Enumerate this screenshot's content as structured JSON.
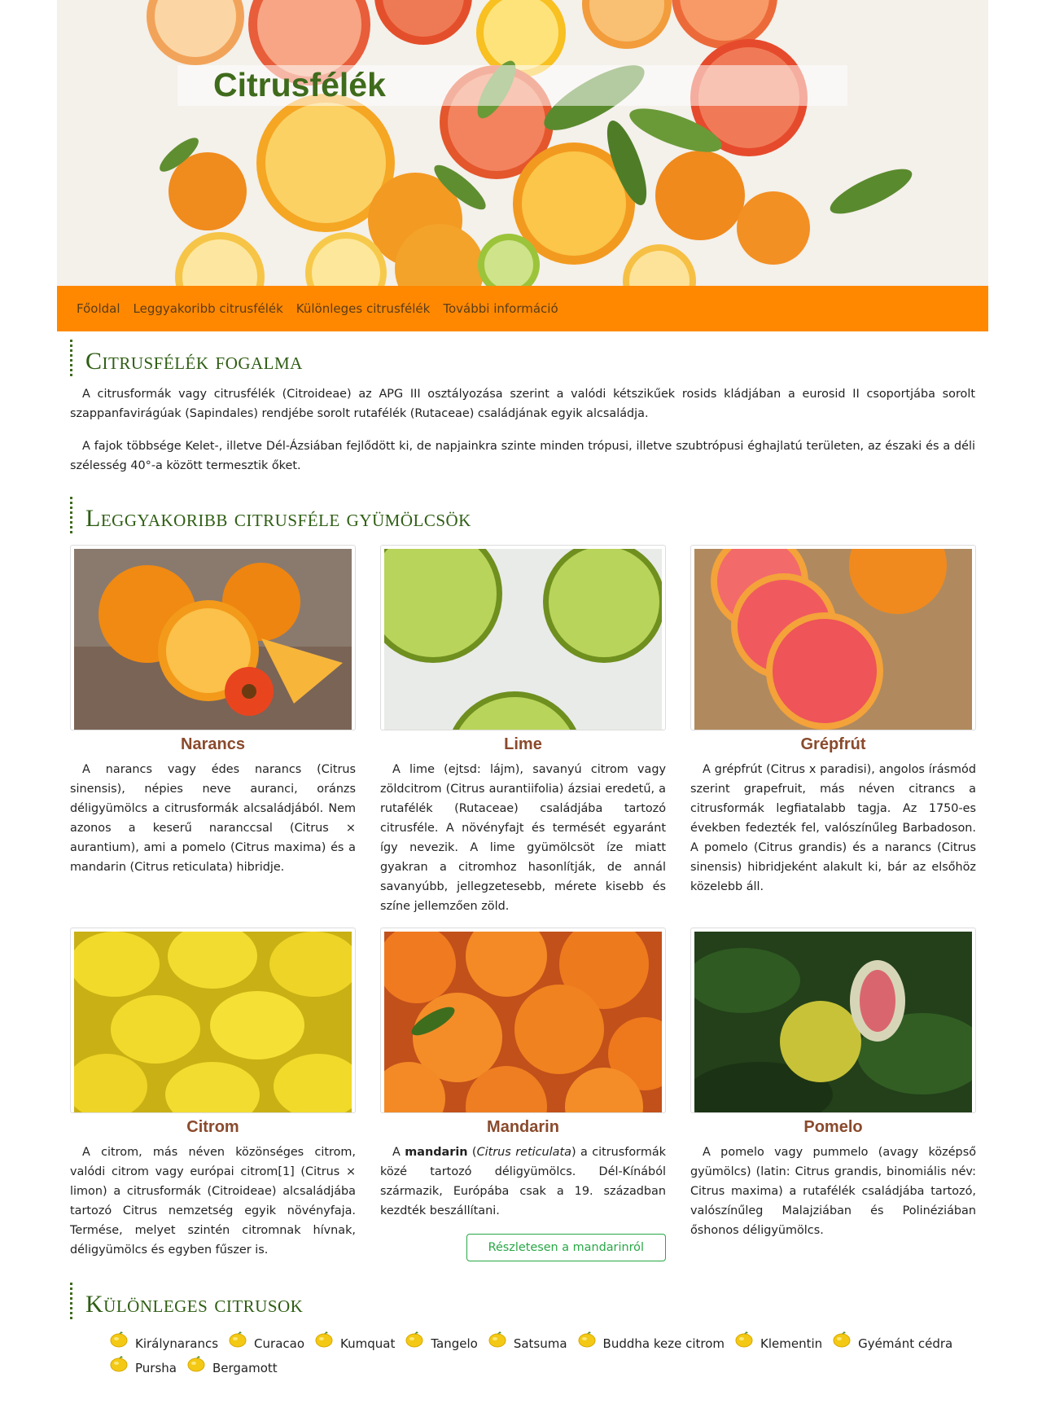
{
  "header": {
    "title": "Citrusfélék"
  },
  "nav": {
    "items": [
      "Főoldal",
      "Leggyakoribb citrusfélék",
      "Különleges citrusfélék",
      "További információ"
    ]
  },
  "intro": {
    "heading": "Citrusfélék fogalma",
    "paragraphs": [
      "A citrusformák vagy citrusfélék (Citroideae) az APG III osztályozása szerint a valódi kétszikűek rosids kládjában a eurosid II csoportjába sorolt szappanfavirágúak (Sapindales) rendjébe sorolt rutafélék (Rutaceae) családjának egyik alcsaládja.",
      "A fajok többsége Kelet-, illetve Dél-Ázsiában fejlődött ki, de napjainkra szinte minden trópusi, illetve szubtrópusi éghajlatú területen, az északi és a déli szélesség 40°-a között termesztik őket."
    ]
  },
  "common": {
    "heading": "Leggyakoribb citrusféle gyümölcsök",
    "fruits": [
      {
        "name": "Narancs",
        "text": "A narancs vagy édes narancs (Citrus sinensis), népies neve auranci, oránzs déligyümölcs a citrusformák alcsaládjából. Nem azonos a keserű naranccsal (Citrus × aurantium), ami a pomelo (Citrus maxima) és a mandarin (Citrus reticulata) hibridje."
      },
      {
        "name": "Lime",
        "text": "A lime (ejtsd: lájm), savanyú citrom vagy zöldcitrom (Citrus aurantiifolia) ázsiai eredetű, a rutafélék (Rutaceae) családjába tartozó citrusféle. A növényfajt és termését egyaránt így nevezik. A lime gyümölcsöt íze miatt gyakran a citromhoz hasonlítják, de annál savanyúbb, jellegzetesebb, mérete kisebb és színe jellemzően zöld."
      },
      {
        "name": "Grépfrút",
        "text": "A grépfrút (Citrus x paradisi), angolos írásmód szerint grapefruit, más néven citrancs a citrusformák legfiatalabb tagja. Az 1750-es években fedezték fel, valószínűleg Barbadoson. A pomelo (Citrus grandis) és a narancs (Citrus sinensis) hibridjeként alakult ki, bár az elsőhöz közelebb áll."
      },
      {
        "name": "Citrom",
        "text": "A citrom, más néven közönséges citrom, valódi citrom vagy európai citrom[1] (Citrus × limon) a citrusformák (Citroideae) alcsaládjába tartozó Citrus nemzetség egyik növényfaja. Termése, melyet szintén citromnak hívnak, déligyümölcs és egyben fűszer is."
      },
      {
        "name": "Mandarin",
        "text_bold": "mandarin",
        "text_pre": "A ",
        "text_italic": "Citrus reticulata",
        "text_mid": " (",
        "text_post": ") a citrusformák közé tartozó déligyümölcs. Dél-Kínából származik, Európába csak a 19. században kezdték beszállítani.",
        "button": "Részletesen a mandarinról"
      },
      {
        "name": "Pomelo",
        "text": "A pomelo vagy pummelo (avagy középső gyümölcs) (latin: Citrus grandis, binomiális név: Citrus maxima) a rutafélék családjába tartozó, valószínűleg Malajziában és Polinéziában őshonos déligyümölcs."
      }
    ]
  },
  "special": {
    "heading": "Különleges citrusok",
    "icon": "lemon-icon",
    "items": [
      "Királynarancs",
      "Curacao",
      "Kumquat",
      "Tangelo",
      "Satsuma",
      "Buddha keze citrom",
      "Klementin",
      "Gyémánt cédra",
      "Pursha",
      "Bergamott"
    ]
  },
  "colors": {
    "nav": "#ff8800",
    "heading": "#2f5e14",
    "fruit_name": "#8a4a2c",
    "button": "#28a745"
  }
}
